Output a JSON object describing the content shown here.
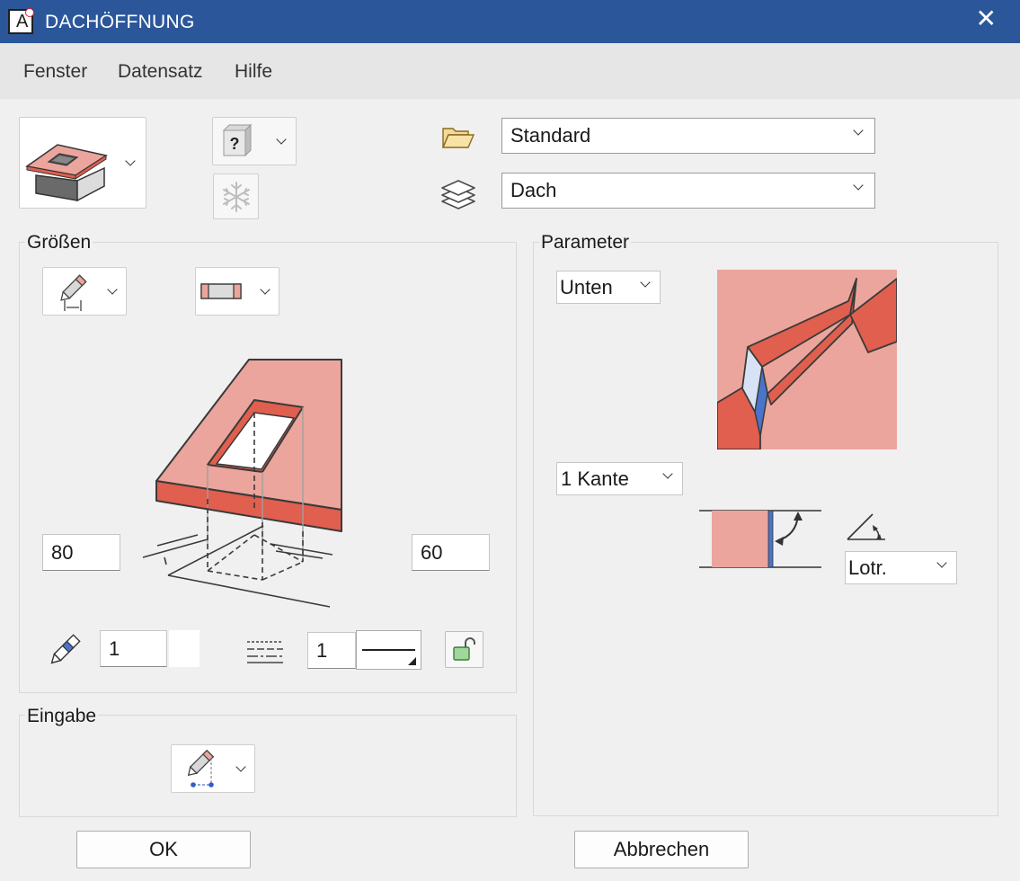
{
  "window": {
    "title": "DACHÖFFNUNG",
    "app_icon_letter": "A",
    "close_glyph": "✕"
  },
  "menu": {
    "items": [
      "Fenster",
      "Datensatz",
      "Hilfe"
    ]
  },
  "toolbar": {
    "help_glyph": "?",
    "style_select": "Standard",
    "layer_select": "Dach"
  },
  "groessen": {
    "label": "Größen",
    "width_value": "80",
    "depth_value": "60",
    "pen_value": "1",
    "linetype_value": "1"
  },
  "parameter": {
    "label": "Parameter",
    "position_select": "Unten",
    "edge_select": "1 Kante",
    "angle_select": "Lotr."
  },
  "eingabe": {
    "label": "Eingabe"
  },
  "buttons": {
    "ok": "OK",
    "cancel": "Abbrechen"
  },
  "colors": {
    "titlebar": "#2b579a",
    "roof_light": "#eba59c",
    "roof_dark": "#e05f4e",
    "accent_blue": "#4a74c9"
  }
}
